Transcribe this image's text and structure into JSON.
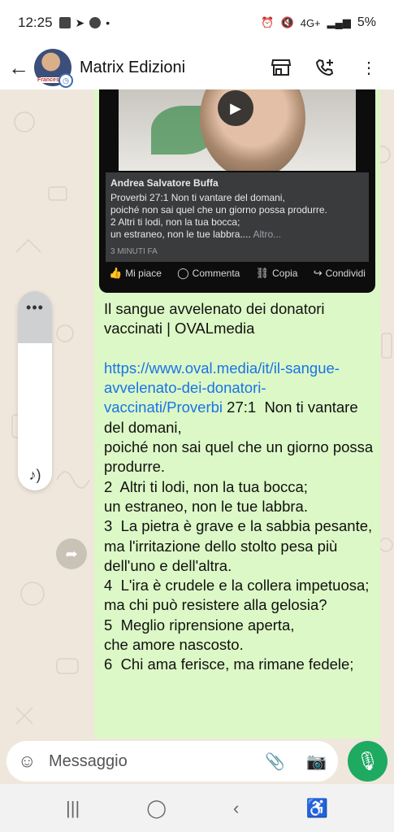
{
  "status_bar": {
    "time": "12:25",
    "network": "4G+",
    "battery": "5%"
  },
  "header": {
    "title": "Matrix Edizioni",
    "avatar_badge": "Francesco"
  },
  "media_preview": {
    "author": "Andrea Salvatore Buffa",
    "text_line1": "Proverbi 27:1  Non ti vantare del domani,",
    "text_line2": "poiché non sai quel che un giorno possa produrre.",
    "text_line3": "2  Altri ti lodi, non la tua bocca;",
    "text_line4": "un estraneo, non le tue labbra....",
    "more_label": "Altro...",
    "time_ago": "3 MINUTI FA",
    "actions": [
      {
        "label": "Mi piace"
      },
      {
        "label": "Commenta"
      },
      {
        "label": "Copia"
      },
      {
        "label": "Condividi"
      }
    ]
  },
  "message": {
    "title_line": "Il sangue avvelenato dei donatori vaccinati | OVALmedia",
    "link": "https://www.oval.media/it/il-sangue-avvelenato-dei-donatori-vaccinati/Proverbi",
    "body": " 27:1  Non ti vantare del domani,\npoiché non sai quel che un giorno possa produrre.\n2  Altri ti lodi, non la tua bocca;\nun estraneo, non le tue labbra.\n3  La pietra è grave e la sabbia pesante,\nma l'irritazione dello stolto pesa più dell'uno e dell'altra.\n4  L'ira è crudele e la collera impetuosa;\nma chi può resistere alla gelosia?\n5  Meglio riprensione aperta,\nche amore nascosto.\n6  Chi ama ferisce, ma rimane fedele;"
  },
  "input": {
    "placeholder": "Messaggio"
  },
  "colors": {
    "bubble": "#dcf8c6",
    "link": "#1a73e8",
    "mic_button": "#1eaa61",
    "chat_bg": "#efe7dc"
  },
  "icons": {
    "back": "back-arrow-icon",
    "shop": "store-icon",
    "call": "add-call-icon",
    "menu": "more-vert-icon",
    "volume_more": "more-horiz-icon",
    "volume_note": "music-note-icon",
    "forward": "forward-icon",
    "emoji": "emoji-icon",
    "attach": "attach-icon",
    "camera": "camera-icon",
    "mic": "mic-icon",
    "nav_recents": "recents-icon",
    "nav_home": "home-icon",
    "nav_back": "nav-back-icon",
    "accessibility": "accessibility-icon"
  }
}
